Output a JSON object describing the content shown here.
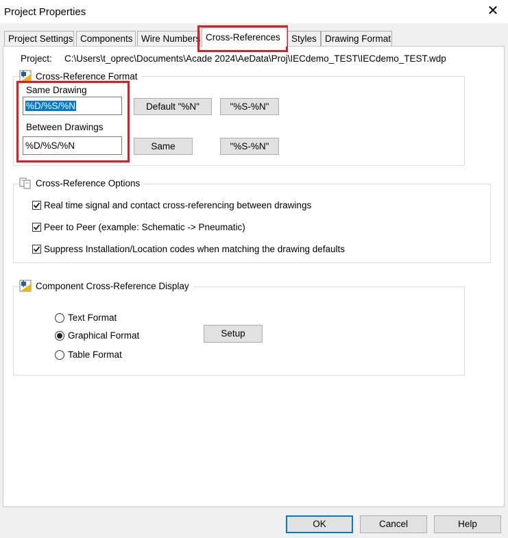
{
  "window": {
    "title": "Project Properties"
  },
  "tabs": [
    {
      "label": "Project Settings",
      "active": false
    },
    {
      "label": "Components",
      "active": false
    },
    {
      "label": "Wire Numbers",
      "active": false
    },
    {
      "label": "Cross-References",
      "active": true
    },
    {
      "label": "Styles",
      "active": false
    },
    {
      "label": "Drawing Format",
      "active": false
    }
  ],
  "project": {
    "label": "Project:",
    "path": "C:\\Users\\t_oprec\\Documents\\Acade 2024\\AeData\\Proj\\IECdemo_TEST\\IECdemo_TEST.wdp"
  },
  "xref_format": {
    "title": "Cross-Reference Format",
    "same_drawing_label": "Same Drawing",
    "same_drawing_value": "%D/%S/%N",
    "between_drawings_label": "Between Drawings",
    "between_drawings_value": "%D/%S/%N",
    "default_button": "Default \"%N\"",
    "s_n_button_1": "\"%S-%N\"",
    "same_button": "Same",
    "s_n_button_2": "\"%S-%N\""
  },
  "xref_options": {
    "title": "Cross-Reference Options",
    "items": [
      {
        "label": "Real time signal and contact cross-referencing between drawings",
        "checked": true
      },
      {
        "label": "Peer to Peer (example: Schematic -> Pneumatic)",
        "checked": true
      },
      {
        "label": "Suppress Installation/Location codes when matching the drawing defaults",
        "checked": true
      }
    ]
  },
  "component_display": {
    "title": "Component Cross-Reference Display",
    "options": [
      {
        "label": "Text Format",
        "selected": false
      },
      {
        "label": "Graphical Format",
        "selected": true
      },
      {
        "label": "Table Format",
        "selected": false
      }
    ],
    "setup_button": "Setup"
  },
  "footer": {
    "ok": "OK",
    "cancel": "Cancel",
    "help": "Help"
  },
  "colors": {
    "highlight": "#e01b24",
    "selection": "#0078d7",
    "icon_blue": "#1f5fa8",
    "icon_yellow": "#f2b705"
  }
}
